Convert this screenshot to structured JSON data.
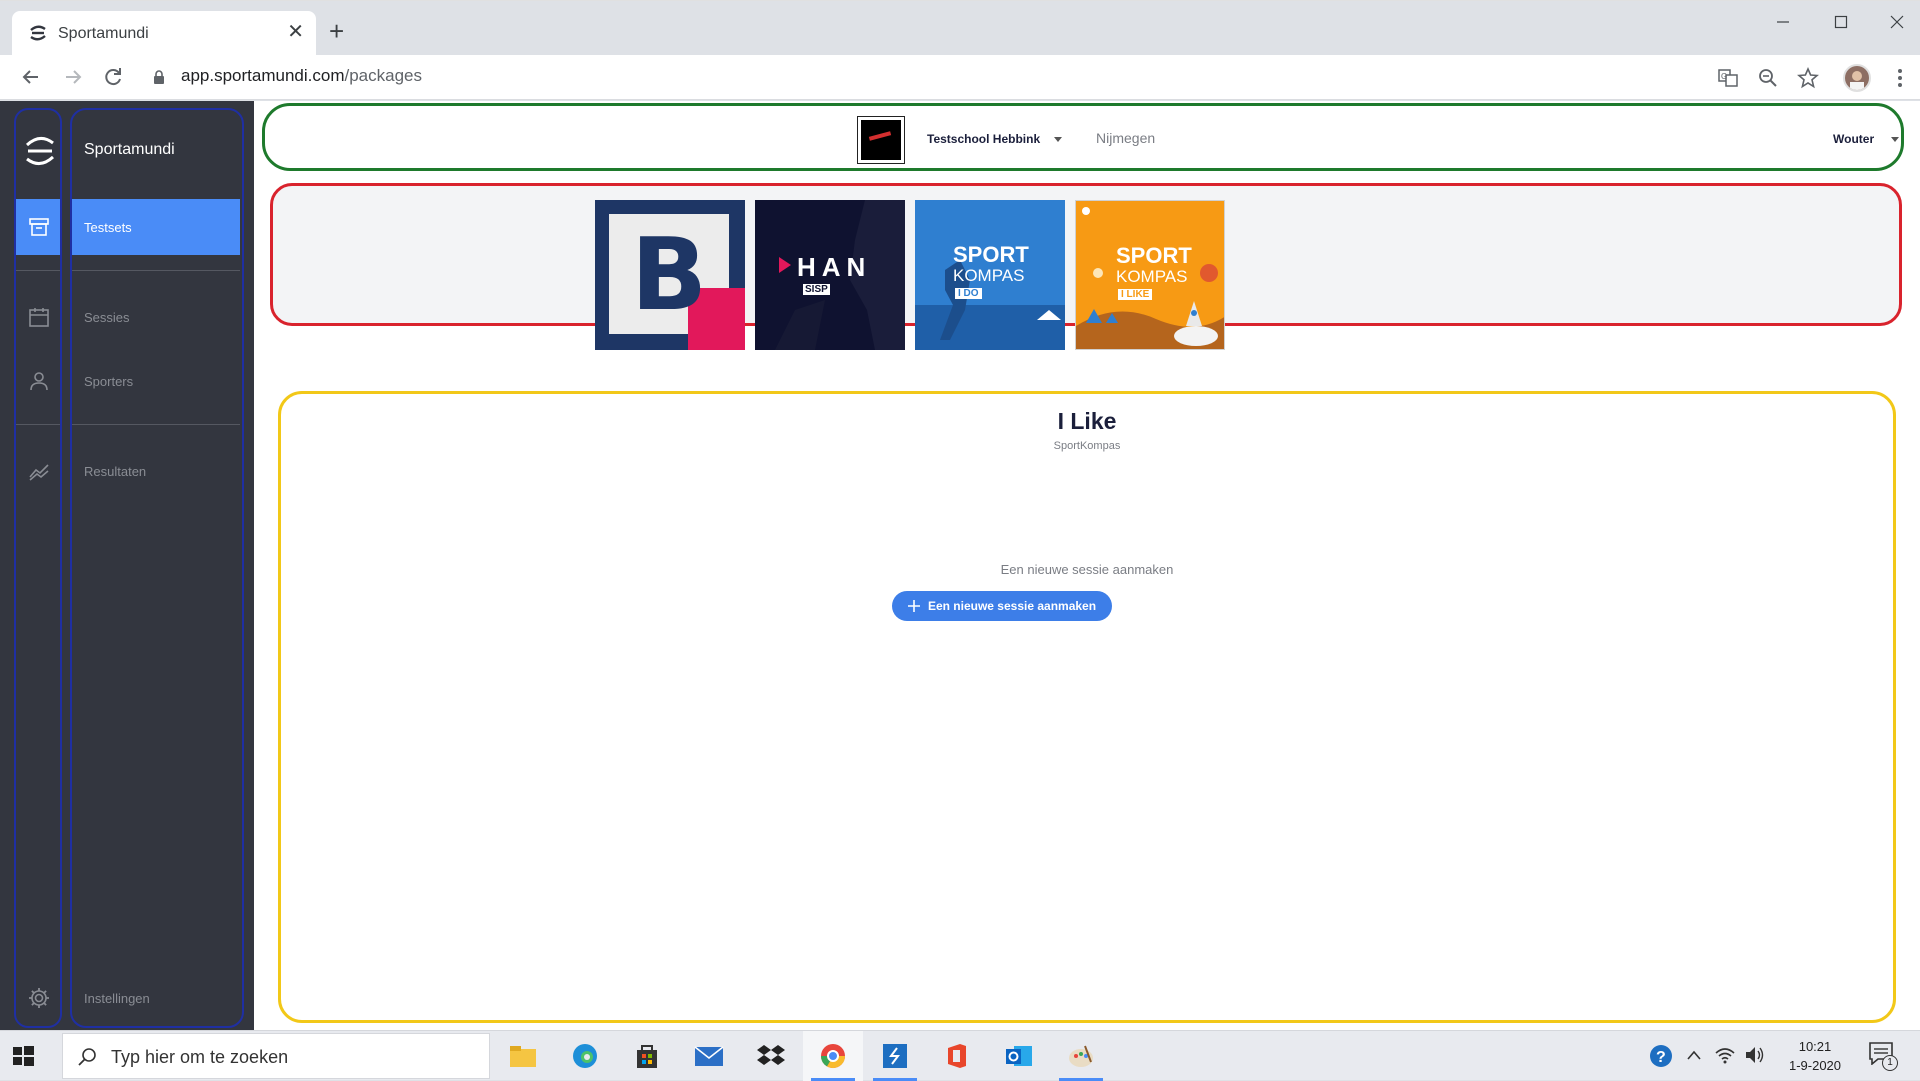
{
  "browser": {
    "tab_title": "Sportamundi",
    "url_domain": "app.sportamundi.com",
    "url_path": "/packages"
  },
  "sidebar": {
    "brand": "Sportamundi",
    "items": [
      {
        "label": "Testsets",
        "icon": "archive-icon",
        "active": true
      },
      {
        "label": "Sessies",
        "icon": "calendar-icon",
        "active": false
      },
      {
        "label": "Sporters",
        "icon": "person-icon",
        "active": false
      },
      {
        "label": "Resultaten",
        "icon": "chart-line-icon",
        "active": false
      },
      {
        "label": "Instellingen",
        "icon": "gear-icon",
        "active": false
      }
    ]
  },
  "topbar": {
    "school_name": "Testschool Hebbink",
    "city": "Nijmegen",
    "user_name": "Wouter"
  },
  "packages": [
    {
      "name": "B",
      "bg": "#1e3665"
    },
    {
      "name": "HAN",
      "tag": "SISP",
      "bg": "#0f1230"
    },
    {
      "name": "SPORT",
      "line2": "KOMPAS",
      "tag": "I DO",
      "bg": "#2f7fd0"
    },
    {
      "name": "SPORT",
      "line2": "KOMPAS",
      "tag": "I LIKE",
      "bg": "#f79a14",
      "selected": true
    }
  ],
  "content": {
    "title": "I Like",
    "subtitle": "SportKompas",
    "empty_text": "Een nieuwe sessie aanmaken",
    "button_label": "Een nieuwe sessie aanmaken"
  },
  "taskbar": {
    "search_placeholder": "Typ hier om te zoeken",
    "time": "10:21",
    "date": "1-9-2020",
    "notification_count": "1"
  },
  "colors": {
    "sidebar": "#33363f",
    "accent": "#4a8cf7",
    "outline_green": "#1e7a2c",
    "outline_red": "#d9232d",
    "outline_yellow": "#f2c818",
    "outline_blue": "#1f2fa3"
  }
}
